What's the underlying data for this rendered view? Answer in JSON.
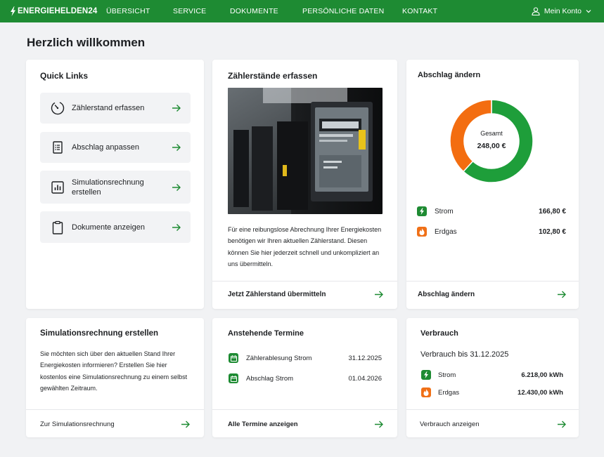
{
  "nav": {
    "logo": "ENERGIEHELDEN24",
    "items": [
      "ÜBERSICHT",
      "SERVICE",
      "DOKUMENTE",
      "PERSÖNLICHE DATEN",
      "KONTAKT"
    ],
    "account": "Mein Konto"
  },
  "page_title": "Herzlich willkommen",
  "quick_links": {
    "title": "Quick Links",
    "items": [
      {
        "label": "Zählerstand erfassen",
        "icon": "gauge-icon"
      },
      {
        "label": "Abschlag anpassen",
        "icon": "invoice-icon"
      },
      {
        "label": "Simulationsrechnung erstellen",
        "icon": "bar-chart-icon"
      },
      {
        "label": "Dokumente anzeigen",
        "icon": "clipboard-icon"
      }
    ]
  },
  "meter_card": {
    "title": "Zählerstände erfassen",
    "text": "Für eine reibungslose Abrechnung Ihrer Energiekosten benötigen wir Ihren aktuellen Zählerstand. Diesen können Sie hier jederzeit schnell und unkompliziert an uns übermitteln.",
    "link": "Jetzt Zählerstand übermitteln"
  },
  "abschlag_card": {
    "title": "Abschlag ändern",
    "total_label": "Gesamt",
    "total_value": "248,00 €",
    "items": [
      {
        "label": "Strom",
        "value": "166,80 €",
        "amount": 166.8,
        "color": "#1e9e3a"
      },
      {
        "label": "Erdgas",
        "value": "102,80 €",
        "amount": 102.8,
        "color": "#f36d10"
      }
    ],
    "link": "Abschlag ändern"
  },
  "simulation_card": {
    "title": "Simulationsrechnung erstellen",
    "text": "Sie möchten sich über den aktuellen Stand Ihrer Energiekosten informieren? Erstellen Sie hier kostenlos eine Simulationsrechnung zu einem selbst gewählten Zeitraum.",
    "link": "Zur Simulationsrechnung"
  },
  "termine_card": {
    "title": "Anstehende Termine",
    "items": [
      {
        "label": "Zählerablesung Strom",
        "date": "31.12.2025"
      },
      {
        "label": "Abschlag Strom",
        "date": "01.04.2026"
      }
    ],
    "link": "Alle Termine anzeigen"
  },
  "verbrauch_card": {
    "title": "Verbrauch",
    "subtitle": "Verbrauch bis 31.12.2025",
    "items": [
      {
        "label": "Strom",
        "value": "6.218,00 kWh"
      },
      {
        "label": "Erdgas",
        "value": "12.430,00 kWh"
      }
    ],
    "link": "Verbrauch anzeigen"
  },
  "colors": {
    "brand": "#1e8b33",
    "gas": "#f07017",
    "background": "#f1f2f4"
  }
}
